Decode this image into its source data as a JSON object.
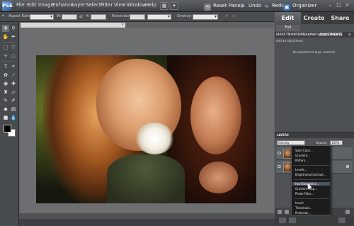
{
  "app": {
    "logo": "PSE"
  },
  "menubar": {
    "items": [
      "File",
      "Edit",
      "Image",
      "Enhance",
      "Layer",
      "Select",
      "Filter",
      "View",
      "Window",
      "Help"
    ],
    "actions": {
      "reset_panels": "Reset Panels",
      "undo": "Undo",
      "redo": "Redo",
      "organizer": "Organizer"
    },
    "window_controls": [
      "–",
      "□",
      "×"
    ]
  },
  "options_bar": {
    "aspect_ratio_label": "Aspect Ratio:",
    "aspect_ratio_value": "",
    "w_label": "W:",
    "h_label": "H:",
    "resolution_label": "Resolution:",
    "resolution_unit": "",
    "overlay_label": "Overlay:",
    "overlay_value": ""
  },
  "mode_tabs": {
    "edit": "Edit",
    "create": "Create",
    "share": "Share"
  },
  "sub_tabs": {
    "full": "Full",
    "quick": "",
    "guided": ""
  },
  "panel_tabs": [
    "EFFECTS",
    "CONTENT",
    "GRAPHICS",
    "ADJUSTMENTS"
  ],
  "adjustments": {
    "header": "Add an adjustment",
    "info": "No adjustment layer selected"
  },
  "layers": {
    "title": "LAYERS",
    "blend_mode": "Overlay",
    "opacity_label": "Opacity:",
    "opacity_value": "100%"
  },
  "adjustment_menu": {
    "items": [
      "Solid Color...",
      "Gradient...",
      "Pattern...",
      "Levels...",
      "Brightness/Contrast...",
      "Hue/Saturation...",
      "Gradient Map...",
      "Photo Filter...",
      "Invert",
      "Threshold...",
      "Posterize..."
    ],
    "highlighted_index": 5
  },
  "document": {
    "tab_title": "",
    "zoom": "",
    "doc_info": ""
  }
}
